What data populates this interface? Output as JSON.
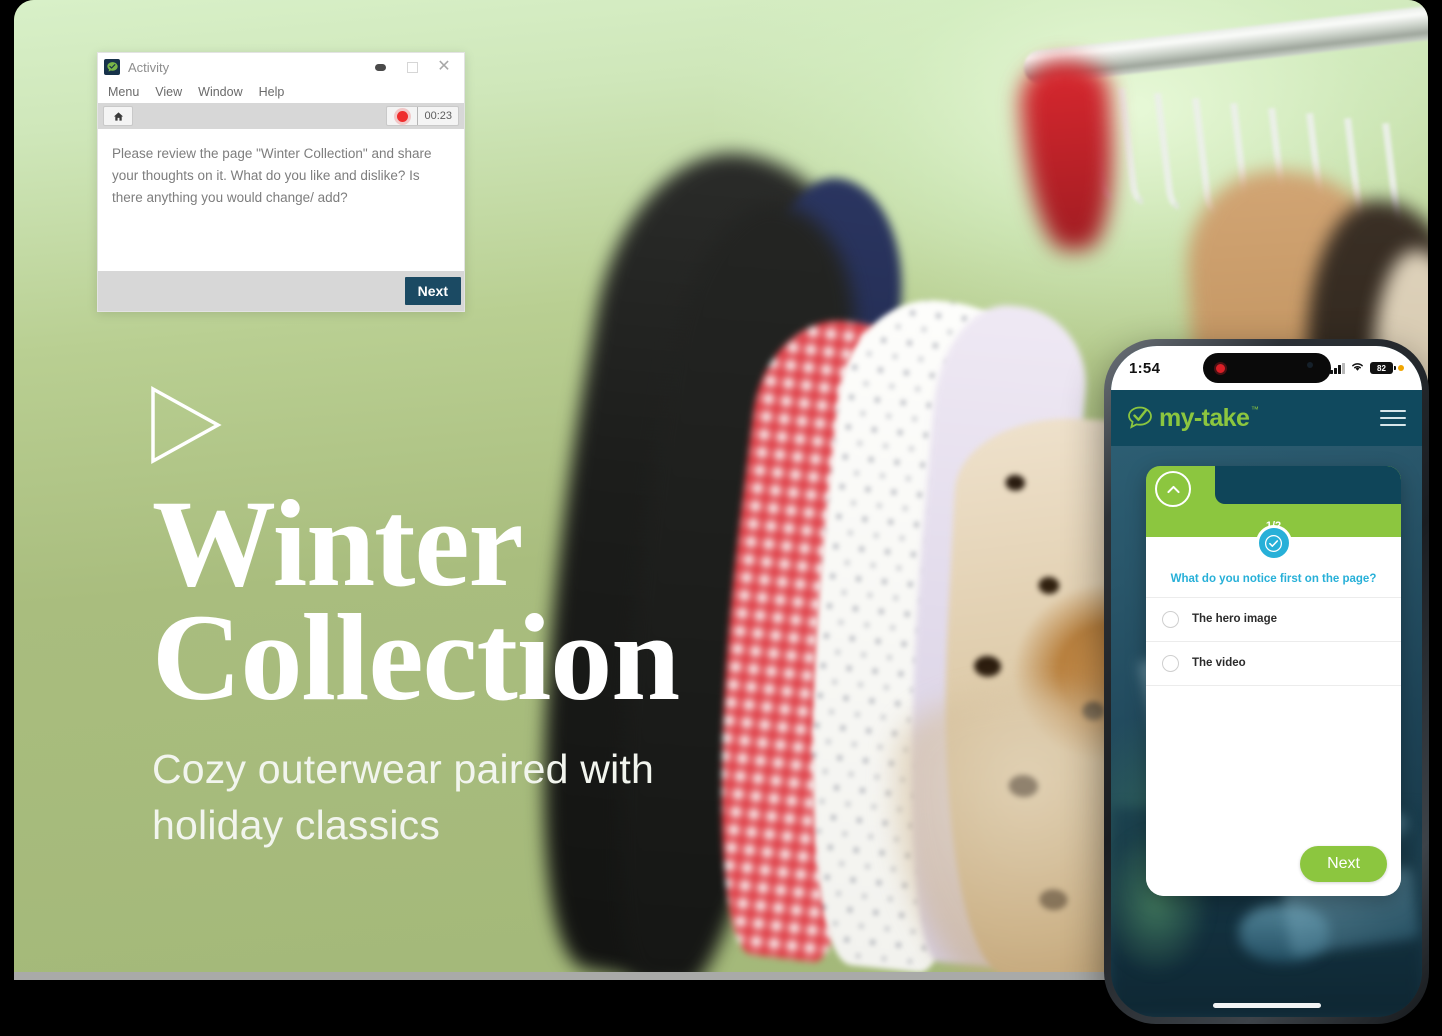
{
  "activity_window": {
    "app_icon": "mytake-logo-icon",
    "title": "Activity",
    "window_controls": {
      "minimize": "minimize-icon",
      "maximize": "maximize-icon",
      "close": "close-icon"
    },
    "menubar": [
      "Menu",
      "View",
      "Window",
      "Help"
    ],
    "toolbar": {
      "home_icon": "home-icon",
      "record_icon": "record-dot-icon",
      "timer": "00:23"
    },
    "prompt": "Please review the page \"Winter Collection\" and share your thoughts on it. What do you like and dislike? Is there anything you would change/ add?",
    "next_label": "Next"
  },
  "hero": {
    "play_icon": "play-triangle-icon",
    "title_line1": "Winter",
    "title_line2": "Collection",
    "subtitle": "Cozy outerwear paired with holiday classics"
  },
  "phone": {
    "status_bar": {
      "time": "1:54",
      "recording_icon": "record-dot-icon",
      "camera_icon": "front-camera-icon",
      "signal_icon": "cellular-signal-icon",
      "wifi_icon": "wifi-icon",
      "battery_level": "82",
      "recording_status_dot": "orange-status-dot-icon"
    },
    "app_header": {
      "logo_mark": "checkmark-speech-bubble-icon",
      "logo_text": "my-take",
      "trademark": "™",
      "menu_icon": "hamburger-menu-icon"
    },
    "survey_card": {
      "collapse_icon": "chevron-up-icon",
      "progress": "1/2",
      "badge_icon": "check-circle-icon",
      "question": "What do you notice first on the page?",
      "answers": [
        {
          "label": "The hero image",
          "radio": "radio-unselected-icon"
        },
        {
          "label": "The video",
          "radio": "radio-unselected-icon"
        }
      ],
      "next_label": "Next"
    }
  },
  "colors": {
    "brand_green": "#8cc63f",
    "brand_teal": "#10495e",
    "accent_cyan": "#27b0d8",
    "record_red": "#d81f26",
    "hero_bg": "#a9bd7e",
    "button_navy": "#1b4a63"
  }
}
